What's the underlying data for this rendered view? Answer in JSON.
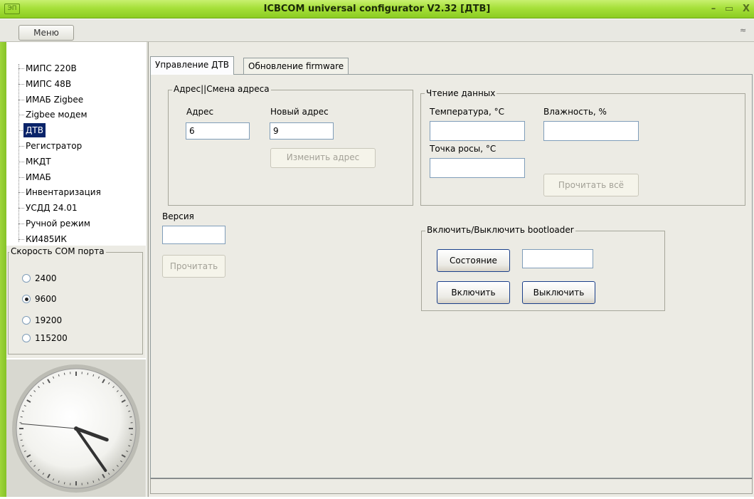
{
  "window": {
    "title": "ICBCOM universal configurator V2.32 [ДТВ]",
    "icon_text": "ЭП",
    "minimize": "–",
    "maximize": "▭",
    "close": "X"
  },
  "menubar": {
    "menu_label": "Меню",
    "collapse_glyph": "≈"
  },
  "tree": {
    "items": [
      {
        "label": "МИПС 220В"
      },
      {
        "label": "МИПС 48В"
      },
      {
        "label": "ИМАБ Zigbee"
      },
      {
        "label": "Zigbee модем"
      },
      {
        "label": "ДТВ",
        "selected": true
      },
      {
        "label": "Регистратор"
      },
      {
        "label": "МКДТ"
      },
      {
        "label": "ИМАБ"
      },
      {
        "label": "Инвентаризация"
      },
      {
        "label": "УСДД 24.01"
      },
      {
        "label": "Ручной режим"
      },
      {
        "label": "КИ485ИК"
      }
    ]
  },
  "com_speed": {
    "legend": "Скорость COM порта",
    "options": [
      "2400",
      "9600",
      "19200",
      "115200"
    ],
    "selected": "9600"
  },
  "tabs": [
    {
      "label": "Управление ДТВ",
      "active": true
    },
    {
      "label": "Обновление firmware",
      "active": false
    }
  ],
  "address_group": {
    "legend": "Адрес||Смена адреса",
    "address_label": "Адрес",
    "address_value": "6",
    "new_address_label": "Новый адрес",
    "new_address_value": "9",
    "change_button": "Изменить адрес"
  },
  "read_group": {
    "legend": "Чтение данных",
    "temperature_label": "Температура, °С",
    "humidity_label": "Влажность, %",
    "dew_point_label": "Точка росы, °С",
    "temperature_value": "",
    "humidity_value": "",
    "dew_point_value": "",
    "read_all_button": "Прочитать всё"
  },
  "version": {
    "label": "Версия",
    "value": "",
    "read_button": "Прочитать"
  },
  "bootloader_group": {
    "legend": "Включить/Выключить bootloader",
    "state_button": "Состояние",
    "state_value": "",
    "enable_button": "Включить",
    "disable_button": "Выключить"
  },
  "clock": {
    "hour_angle_deg": 110,
    "minute_angle_deg": 145,
    "second_angle_deg": 275
  }
}
